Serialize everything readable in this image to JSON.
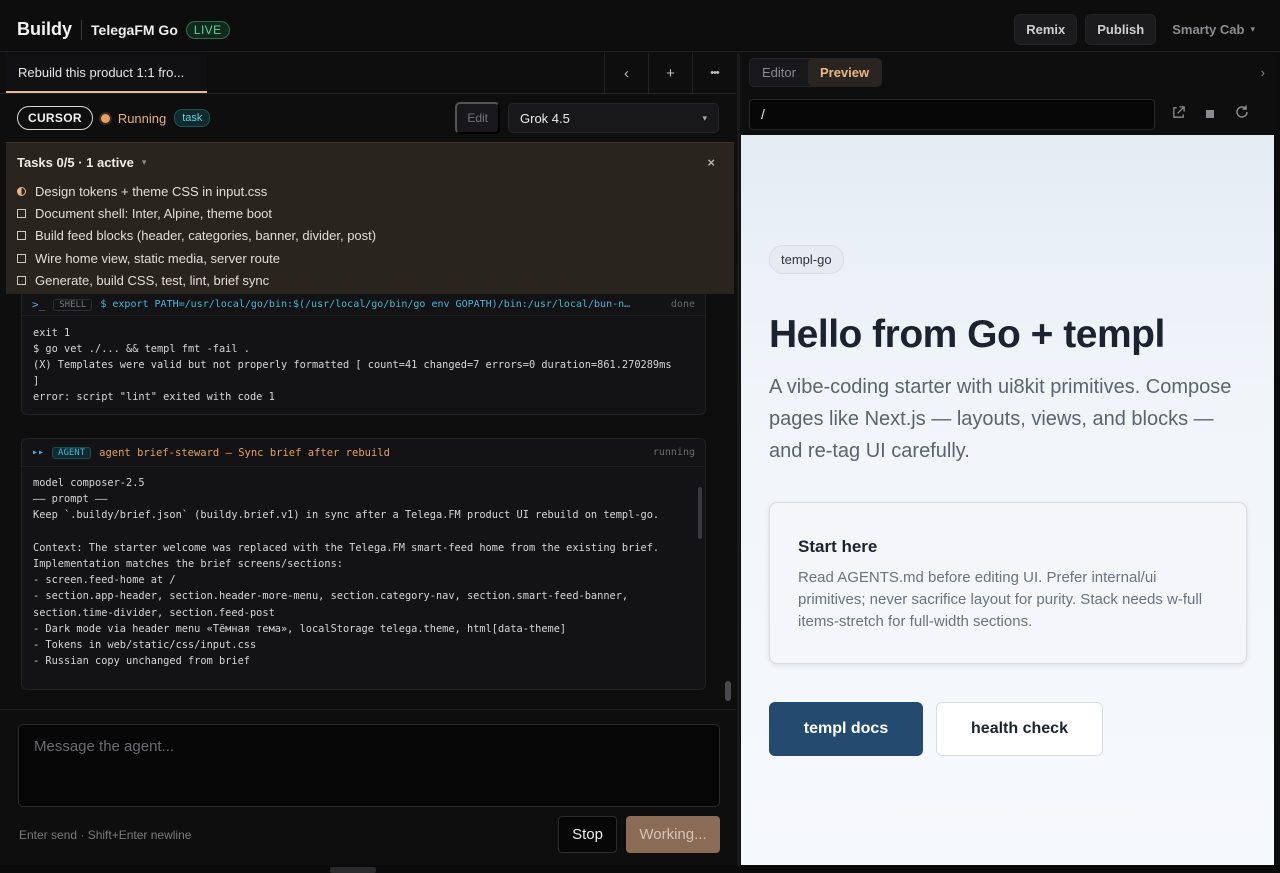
{
  "header": {
    "brand": "Buildy",
    "project": "TelegaFM Go",
    "live": "LIVE",
    "remix": "Remix",
    "publish": "Publish",
    "user": "Smarty Cab"
  },
  "left_tabs": {
    "active": "Rebuild this product 1:1 fro...",
    "prev": "‹",
    "add": "+",
    "more": "•••"
  },
  "status": {
    "agent": "CURSOR",
    "state": "Running",
    "badge": "task",
    "edit": "Edit",
    "model": "Grok 4.5"
  },
  "tasks": {
    "header": "Tasks 0/5 · 1 active",
    "close": "×",
    "items": [
      {
        "label": "Design tokens + theme CSS in input.css",
        "state": "active"
      },
      {
        "label": "Document shell: Inter, Alpine, theme boot",
        "state": "pending"
      },
      {
        "label": "Build feed blocks (header, categories, banner, divider, post)",
        "state": "pending"
      },
      {
        "label": "Wire home view, static media, server route",
        "state": "pending"
      },
      {
        "label": "Generate, build CSS, test, lint, brief sync",
        "state": "pending"
      }
    ]
  },
  "shell": {
    "prompt": ">_",
    "tag": "SHELL",
    "command": "$ export PATH=/usr/local/go/bin:$(/usr/local/go/bin/go env GOPATH)/bin:/usr/local/bun-n…",
    "status": "done",
    "output": "exit 1\n$ go vet ./... && templ fmt -fail .\n(X) Templates were valid but not properly formatted [ count=41 changed=7 errors=0 duration=861.270289ms\n]\nerror: script \"lint\" exited with code 1"
  },
  "agent": {
    "symbol": "▸▸",
    "tag": "AGENT",
    "title": "agent brief-steward — Sync brief after rebuild",
    "status": "running",
    "body": "model composer-2.5\n—— prompt ——\nKeep `.buildy/brief.json` (buildy.brief.v1) in sync after a Telega.FM product UI rebuild on templ-go.\n\nContext: The starter welcome was replaced with the Telega.FM smart-feed home from the existing brief.\nImplementation matches the brief screens/sections:\n- screen.feed-home at /\n- section.app-header, section.header-more-menu, section.category-nav, section.smart-feed-banner,\nsection.time-divider, section.feed-post\n- Dark mode via header menu «Тёмная тема», localStorage telega.theme, html[data-theme]\n- Tokens in web/static/css/input.css\n- Russian copy unchanged from brief"
  },
  "composer": {
    "placeholder": "Message the agent...",
    "hint": "Enter send · Shift+Enter newline",
    "stop": "Stop",
    "working": "Working..."
  },
  "right_panel": {
    "tab_editor": "Editor",
    "tab_preview": "Preview",
    "chevron": "›",
    "url": "/",
    "icons": [
      "external-link-icon",
      "stop-icon",
      "reload-icon"
    ]
  },
  "preview": {
    "chip": "templ-go",
    "title": "Hello from Go + templ",
    "subtitle": "A vibe-coding starter with ui8kit primitives. Compose pages like Next.js — layouts, views, and blocks — and re-tag UI carefully.",
    "card_title": "Start here",
    "card_text": "Read AGENTS.md before editing UI. Prefer internal/ui primitives; never sacrifice layout for purity. Stack needs w-full items-stretch for full-width sections.",
    "btn_primary": "templ docs",
    "btn_secondary": "health check"
  },
  "colors": {
    "accent": "#e8b688",
    "live": "#5dd39a",
    "primary_button": "#244a70",
    "task_panel": "#2a241f"
  }
}
